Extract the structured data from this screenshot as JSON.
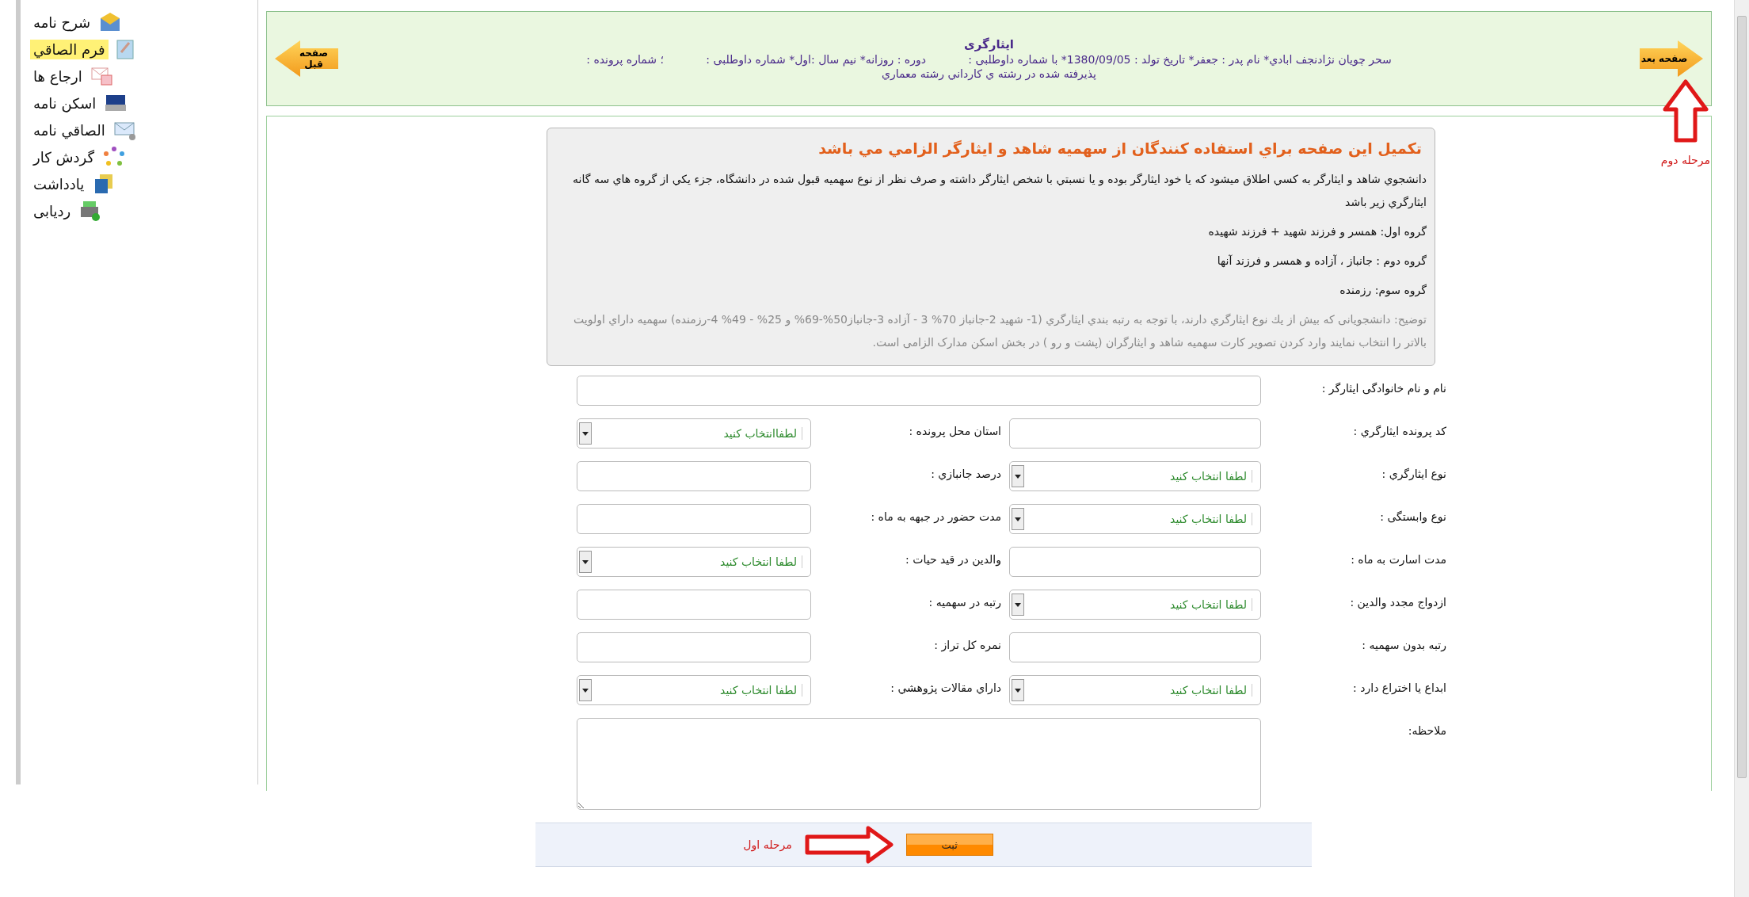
{
  "sidebar": {
    "items": [
      {
        "label": "شرح نامه",
        "selected": false
      },
      {
        "label": "فرم الصاقي",
        "selected": true
      },
      {
        "label": "ارجاع ها",
        "selected": false
      },
      {
        "label": "اسکن نامه",
        "selected": false
      },
      {
        "label": "الصاقي نامه",
        "selected": false
      },
      {
        "label": "گردش کار",
        "selected": false
      },
      {
        "label": "یادداشت",
        "selected": false
      },
      {
        "label": "ردیابی",
        "selected": false
      }
    ]
  },
  "header": {
    "title": "ایثارگری",
    "lines": [
      "سحر چویان نژادنجف ابادي* نام پدر : جعفر* تاریخ تولد : 1380/09/05* با شماره داوطلبی :            دوره : روزانه* نیم سال :اول* شماره داوطلبی :            ؛ شماره پرونده :",
      "پذیرفته شده در رشته ي كارداني رشته معماري"
    ],
    "next_button": "صفحه بعد",
    "prev_button": "صفحه قبل",
    "annotation": "مرحله دوم"
  },
  "notice": {
    "heading": "تکمیل این صفحه براي استفاده کنندگان از سهمیه شاهد و ایثارگر الزامي مي باشد",
    "paragraphs": [
      "دانشجوي شاهد و ايثارگر به كسي اطلاق ميشود كه يا خود ايثارگر بوده و يا نسبتي با شخص ايثارگر داشته و صرف نظر از نوع سهميه قبول شده در دانشگاه، جزء يكي از گروه هاي سه گانه ايثارگري زير باشد",
      "گروه اول: همسر و فرزند شهید + فرزند شهیده",
      "گروه دوم : جانباز ، آزاده و همسر و فرزند آنها",
      "گروه سوم: رزمنده"
    ],
    "note": "توضیح: دانشجویانی که بیش از يك نوع ايثارگري دارند، با توجه به رتبه بندي ايثارگري (1- شهید 2-جانباز 70% 3 - آزاده 3-جانباز50%-69% و 25% - 49% 4-رزمنده) سهمیه داراي اولويت بالاتر را انتخاب نمایند وارد کردن تصویر کارت سهمیه شاهد و ایثارگران (پشت و رو ) در بخش اسکن مدارک الزامی است."
  },
  "form": {
    "rows": [
      [
        {
          "kind": "wide",
          "label": "نام و نام خانوادگی ایثارگر :"
        }
      ],
      [
        {
          "kind": "text",
          "label": "کد پرونده ايثارگري :"
        },
        {
          "kind": "select",
          "label": "استان محل پرونده :",
          "value": "لطفاانتخاب کنید"
        }
      ],
      [
        {
          "kind": "select",
          "label": "نوع ايثارگري :",
          "value": "لطفا انتخاب کنید"
        },
        {
          "kind": "text",
          "label": "درصد جانبازي :"
        }
      ],
      [
        {
          "kind": "select",
          "label": "نوع وابستگی :",
          "value": "لطفا انتخاب کنید"
        },
        {
          "kind": "text",
          "label": "مدت حضور در جبهه به ماه :"
        }
      ],
      [
        {
          "kind": "text",
          "label": "مدت اسارت به ماه :"
        },
        {
          "kind": "select",
          "label": "والدين در قيد حيات :",
          "value": "لطفا انتخاب کنید"
        }
      ],
      [
        {
          "kind": "select",
          "label": "ازدواج مجدد والدين :",
          "value": "لطفا انتخاب کنید"
        },
        {
          "kind": "text",
          "label": "رتبه در سهميه :"
        }
      ],
      [
        {
          "kind": "text",
          "label": "رتبه بدون سهميه :"
        },
        {
          "kind": "text",
          "label": "نمره کل تراز :"
        }
      ],
      [
        {
          "kind": "select",
          "label": "ابداع یا اختراع دارد :",
          "value": "لطفا انتخاب کنید"
        },
        {
          "kind": "select",
          "label": "داراي مقالات پژوهشي :",
          "value": "لطفا انتخاب کنید"
        }
      ],
      [
        {
          "kind": "textarea",
          "label": "ملاحظه:"
        }
      ]
    ]
  },
  "footer": {
    "submit": "ثبت",
    "annotation": "مرحله اول"
  }
}
